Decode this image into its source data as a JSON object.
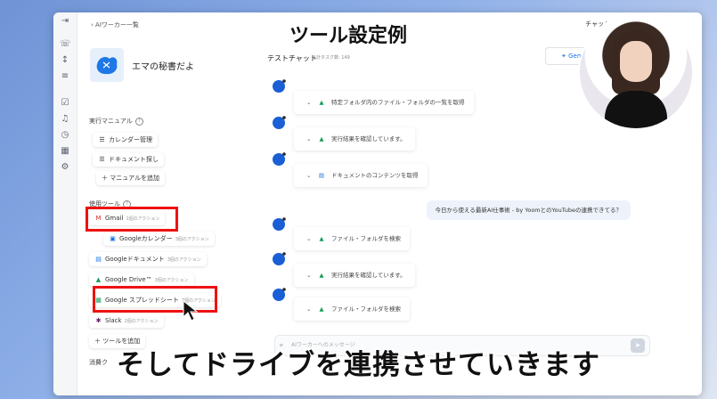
{
  "overlay_title": "ツール設定例",
  "subtitle": "そしてドライブを連携させていきます",
  "header": {
    "back_label": "AIワーカー一覧",
    "top_right_label": "チャットページへ"
  },
  "agent": {
    "name": "エマの秘書だよ"
  },
  "manuals": {
    "section_label": "実行マニュアル",
    "items": [
      "カレンダー管理",
      "ドキュメント探し"
    ],
    "add_label": "マニュアルを追加"
  },
  "tools": {
    "section_label": "使用ツール",
    "items": [
      {
        "name": "Gmail",
        "count": "1個のアクション",
        "icon": "gmail-icon"
      },
      {
        "name": "Googleカレンダー",
        "count": "3個のアクション",
        "icon": "calendar-icon"
      },
      {
        "name": "Googleドキュメント",
        "count": "3個のアクション",
        "icon": "docs-icon"
      },
      {
        "name": "Google Drive™",
        "count": "3個のアクション",
        "icon": "drive-icon"
      },
      {
        "name": "Google スプレッドシート",
        "count": "7個のアクション",
        "icon": "sheets-icon"
      },
      {
        "name": "Slack",
        "count": "2個のアクション",
        "icon": "slack-icon"
      }
    ],
    "add_label": "ツールを追加",
    "bottom_label": "消費ク"
  },
  "chat": {
    "title": "テストチャット",
    "subtitle": "合計タスク数: 149",
    "model_label": "Gemini",
    "steps": [
      {
        "text": "特定フォルダ内のファイル・フォルダの一覧を取得",
        "icon": "drive-icon"
      },
      {
        "text": "実行結果を確認しています。",
        "icon": "drive-icon"
      },
      {
        "text": "ドキュメントのコンテンツを取得",
        "icon": "docs-icon"
      },
      {
        "text": "ファイル・フォルダを検索",
        "icon": "drive-icon"
      },
      {
        "text": "実行結果を確認しています。",
        "icon": "drive-icon"
      },
      {
        "text": "ファイル・フォルダを検索",
        "icon": "drive-icon"
      }
    ],
    "user_message": "今日から使える最新AI仕事術 - by YoomとのYouTubeの連携できてる？",
    "input_placeholder": "AIワーカーへのメッセージ"
  }
}
